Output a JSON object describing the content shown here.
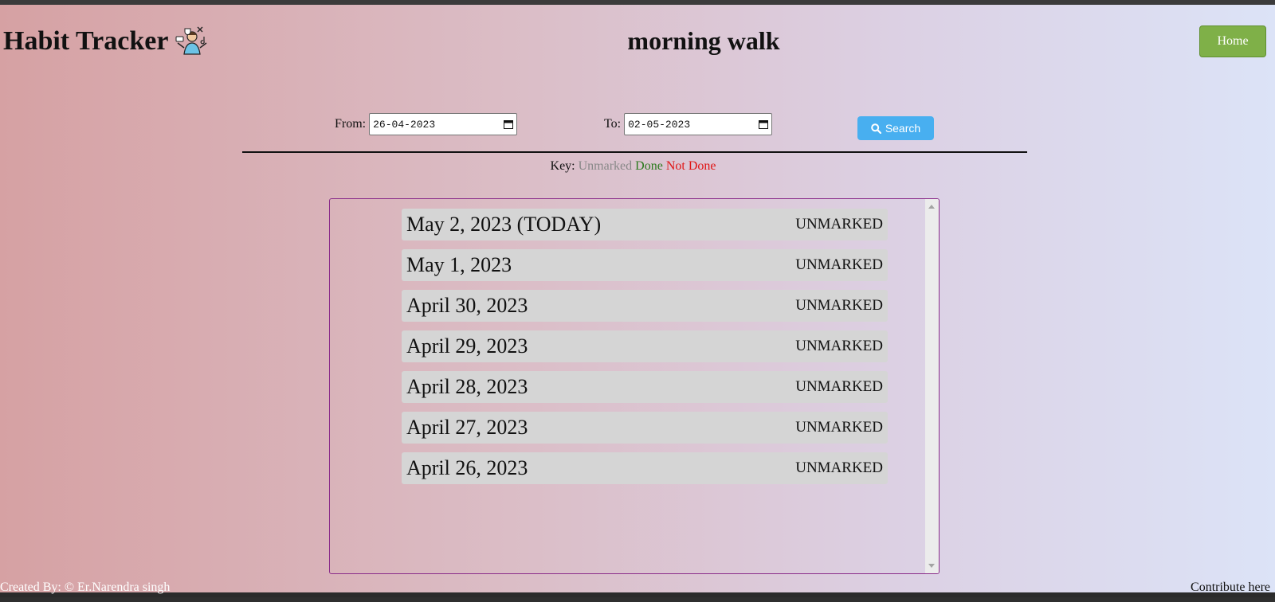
{
  "app": {
    "title": "Habit Tracker",
    "logo_icon": "person-habits-icon"
  },
  "habit": {
    "name": "morning walk"
  },
  "nav": {
    "home_label": "Home"
  },
  "filter": {
    "from_label": "From:",
    "from_value": "26-04-2023",
    "to_label": "To:",
    "to_value": "02-05-2023",
    "search_label": "Search"
  },
  "key": {
    "label": "Key:",
    "unmarked": "Unmarked",
    "done": "Done",
    "not_done": "Not Done"
  },
  "days": [
    {
      "date": "May 2, 2023 (TODAY)",
      "status": "UNMARKED"
    },
    {
      "date": "May 1, 2023",
      "status": "UNMARKED"
    },
    {
      "date": "April 30, 2023",
      "status": "UNMARKED"
    },
    {
      "date": "April 29, 2023",
      "status": "UNMARKED"
    },
    {
      "date": "April 28, 2023",
      "status": "UNMARKED"
    },
    {
      "date": "April 27, 2023",
      "status": "UNMARKED"
    },
    {
      "date": "April 26, 2023",
      "status": "UNMARKED"
    }
  ],
  "footer": {
    "credit": "Created By: © Er.Narendra singh",
    "contribute": "Contribute here"
  },
  "colors": {
    "home_button": "#7fb048",
    "search_button": "#48aff0",
    "key_done": "#2c7a1e",
    "key_not_done": "#e01515",
    "key_unmarked": "#888888",
    "panel_border": "#8a2c8a"
  }
}
